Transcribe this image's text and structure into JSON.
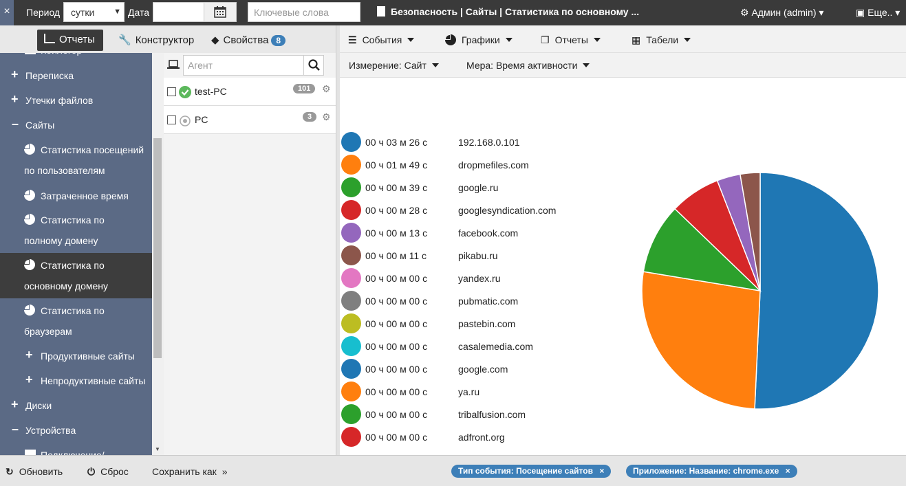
{
  "topbar": {
    "close": "×",
    "period_label": "Период",
    "period_value": "сутки",
    "date_label": "Дата",
    "keywords_placeholder": "Ключевые слова",
    "title": "Безопасность | Сайты | Статистика по основному ...",
    "admin": "Админ (admin)",
    "more": "Еще.."
  },
  "tabs": {
    "reports": "Отчеты",
    "builder": "Конструктор",
    "properties": "Свойства",
    "properties_count": "8"
  },
  "sidebar": {
    "items": [
      {
        "label": "Кейлогер",
        "icon": "grid-icon"
      },
      {
        "label": "Переписка",
        "icon": "plus-icon"
      },
      {
        "label": "Утечки файлов",
        "icon": "plus-icon"
      },
      {
        "label": "Сайты",
        "icon": "minus-icon"
      },
      {
        "label": "Статистика посещений по пользователям",
        "icon": "pie-icon"
      },
      {
        "label": "Затраченное время",
        "icon": "pie-icon"
      },
      {
        "label": "Статистика по полному домену",
        "icon": "pie-icon"
      },
      {
        "label": "Статистика по основному домену",
        "icon": "pie-icon"
      },
      {
        "label": "Статистика по браузерам",
        "icon": "pie-icon"
      },
      {
        "label": "Продуктивные сайты",
        "icon": "plus-icon"
      },
      {
        "label": "Непродуктивные сайты",
        "icon": "plus-icon"
      },
      {
        "label": "Диски",
        "icon": "plus-icon"
      },
      {
        "label": "Устройства",
        "icon": "minus-icon"
      },
      {
        "label": "Подключение/",
        "icon": "grid-icon"
      }
    ]
  },
  "agents": {
    "search_placeholder": "Агент",
    "rows": [
      {
        "name": "test-PC",
        "count": "101",
        "status": "online"
      },
      {
        "name": "PC",
        "count": "3",
        "status": "offline"
      }
    ]
  },
  "main_toolbar": {
    "events": "События",
    "charts": "Графики",
    "reports": "Отчеты",
    "tables": "Табели"
  },
  "dimension": {
    "dimension_label": "Измерение: Сайт",
    "measure_label": "Мера: Время активности"
  },
  "colors": {
    "blue": "#1f77b4",
    "orange": "#ff7f0e",
    "green": "#2ca02c",
    "red": "#d62728",
    "purple": "#9467bd",
    "brown": "#8c564b",
    "pink": "#e377c2",
    "gray": "#7f7f7f",
    "olive": "#bcbd22",
    "cyan": "#17becf"
  },
  "chart_data": {
    "type": "pie",
    "categories": [
      "192.168.0.101",
      "dropmefiles.com",
      "google.ru",
      "googlesyndication.com",
      "facebook.com",
      "pikabu.ru",
      "yandex.ru",
      "pubmatic.com",
      "pastebin.com",
      "casalemedia.com",
      "google.com",
      "ya.ru",
      "tribalfusion.com",
      "adfront.org"
    ],
    "durations": [
      "00 ч 03 м 26 с",
      "00 ч 01 м 49 с",
      "00 ч 00 м 39 с",
      "00 ч 00 м 28 с",
      "00 ч 00 м 13 с",
      "00 ч 00 м 11 с",
      "00 ч 00 м 00 с",
      "00 ч 00 м 00 с",
      "00 ч 00 м 00 с",
      "00 ч 00 м 00 с",
      "00 ч 00 м 00 с",
      "00 ч 00 м 00 с",
      "00 ч 00 м 00 с",
      "00 ч 00 м 00 с"
    ],
    "values": [
      206,
      109,
      39,
      28,
      13,
      11,
      0,
      0,
      0,
      0,
      0,
      0,
      0,
      0
    ],
    "slice_colors": [
      "#1f77b4",
      "#ff7f0e",
      "#2ca02c",
      "#d62728",
      "#9467bd",
      "#8c564b",
      "#e377c2",
      "#7f7f7f",
      "#bcbd22",
      "#17becf",
      "#1f77b4",
      "#ff7f0e",
      "#2ca02c",
      "#d62728"
    ]
  },
  "bottombar": {
    "refresh": "Обновить",
    "reset": "Сброс",
    "save_as": "Сохранить как",
    "filter_event": "Тип события: Посещение сайтов",
    "filter_app": "Приложение: Название: chrome.exe"
  }
}
